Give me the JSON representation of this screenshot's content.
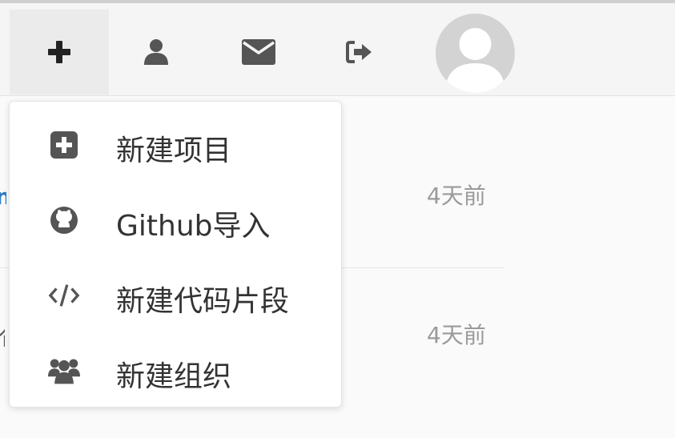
{
  "navbar": {
    "buttons": [
      {
        "name": "new",
        "icon": "plus-icon"
      },
      {
        "name": "profile",
        "icon": "user-icon"
      },
      {
        "name": "messages",
        "icon": "envelope-icon"
      },
      {
        "name": "logout",
        "icon": "sign-out-icon"
      }
    ],
    "avatar_icon": "default-avatar"
  },
  "dropdown": {
    "items": [
      {
        "label": "新建项目",
        "icon": "plus-square-icon"
      },
      {
        "label": "Github导入",
        "icon": "github-icon"
      },
      {
        "label": "新建代码片段",
        "icon": "code-icon"
      },
      {
        "label": "新建组织",
        "icon": "users-icon"
      }
    ]
  },
  "list": {
    "rows": [
      {
        "time": "4天前"
      },
      {
        "time": "4天前"
      }
    ]
  },
  "colors": {
    "icon": "#555555",
    "text": "#333333",
    "muted": "#9a9a9a",
    "link": "#2e7bbf"
  }
}
